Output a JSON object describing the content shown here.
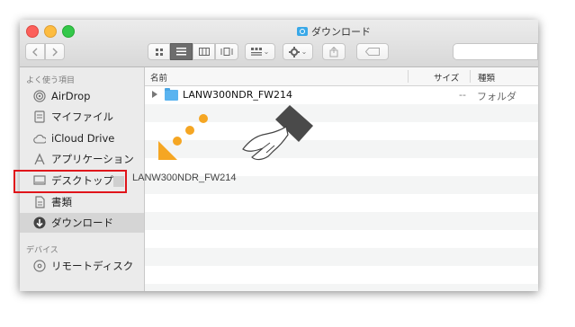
{
  "window": {
    "title": "ダウンロード"
  },
  "toolbar": {
    "back_icon": "chevron-left-icon",
    "forward_icon": "chevron-right-icon",
    "view_icons": [
      "icon-view-icon",
      "list-view-icon",
      "column-view-icon",
      "cover-flow-icon"
    ],
    "arrange_icon": "arrange-icon",
    "action_icon": "gear-icon",
    "share_icon": "share-icon",
    "tag_icon": "tag-icon",
    "chevron": "⌄"
  },
  "sidebar": {
    "favorites_header": "よく使う項目",
    "items": [
      {
        "label": "AirDrop",
        "icon": "airdrop-icon"
      },
      {
        "label": "マイファイル",
        "icon": "all-files-icon"
      },
      {
        "label": "iCloud Drive",
        "icon": "cloud-icon"
      },
      {
        "label": "アプリケーション",
        "icon": "applications-icon"
      },
      {
        "label": "デスクトップ",
        "icon": "desktop-icon"
      },
      {
        "label": "書類",
        "icon": "documents-icon"
      },
      {
        "label": "ダウンロード",
        "icon": "download-icon"
      }
    ],
    "devices_header": "デバイス",
    "devices": [
      {
        "label": "リモートディスク",
        "icon": "disc-icon"
      }
    ]
  },
  "columns": {
    "name": "名前",
    "size": "サイズ",
    "kind": "種類"
  },
  "files": [
    {
      "name": "LANW300NDR_FW214",
      "size": "--",
      "kind": "フォルダ"
    }
  ],
  "drag": {
    "label": "LANW300NDR_FW214"
  },
  "colors": {
    "highlight": "#e0141a",
    "arrow": "#f5a623",
    "folder": "#5ab4f0"
  }
}
